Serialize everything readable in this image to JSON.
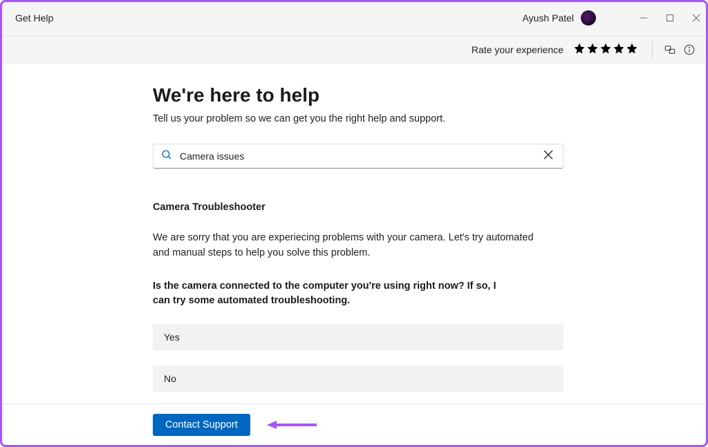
{
  "titlebar": {
    "appName": "Get Help",
    "userName": "Ayush Patel"
  },
  "ratingBar": {
    "label": "Rate your experience",
    "starCount": 5
  },
  "hero": {
    "heading": "We're here to help",
    "subheading": "Tell us your problem so we can get you the right help and support."
  },
  "search": {
    "value": "Camera issues"
  },
  "troubleshooter": {
    "title": "Camera Troubleshooter",
    "description": "We are sorry that you are experiecing problems with your camera. Let's try automated and manual steps to help you solve this problem.",
    "question": "Is the camera connected to the computer you're using right now? If so, I can try some automated troubleshooting.",
    "options": {
      "yes": "Yes",
      "no": "No"
    }
  },
  "footer": {
    "contactLabel": "Contact Support"
  }
}
